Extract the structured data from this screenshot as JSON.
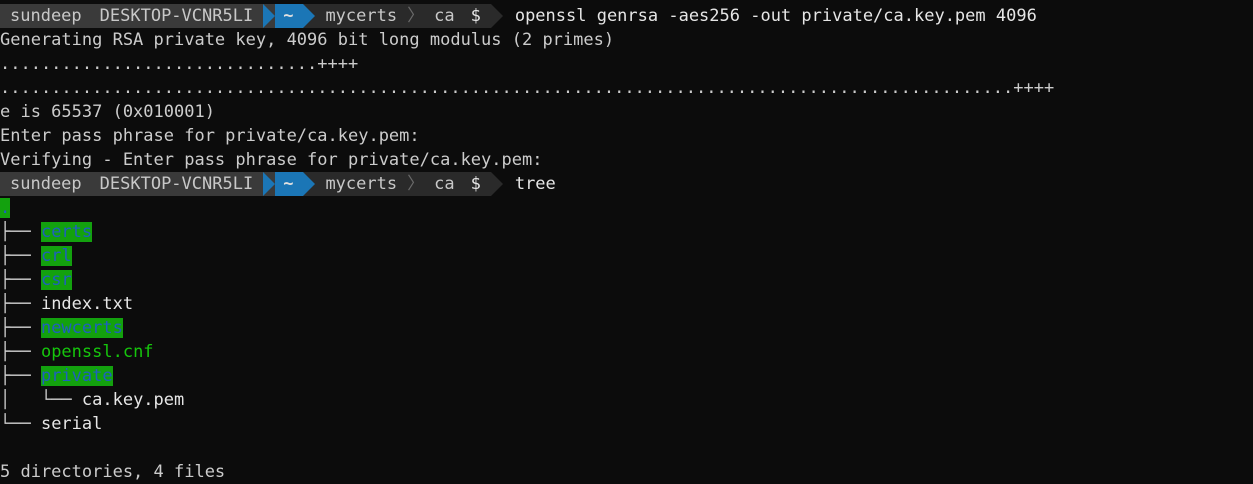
{
  "prompt1": {
    "user": "sundeep",
    "host": "DESKTOP-VCNR5LI",
    "home": "~",
    "dir1": "mycerts",
    "dir2": "ca",
    "dollar": "$",
    "command": "openssl genrsa -aes256 -out private/ca.key.pem 4096"
  },
  "output1": [
    "Generating RSA private key, 4096 bit long modulus (2 primes)",
    "...............................++++",
    "...................................................................................................++++",
    "e is 65537 (0x010001)",
    "Enter pass phrase for private/ca.key.pem:",
    "Verifying - Enter pass phrase for private/ca.key.pem:"
  ],
  "prompt2": {
    "user": "sundeep",
    "host": "DESKTOP-VCNR5LI",
    "home": "~",
    "dir1": "mycerts",
    "dir2": "ca",
    "dollar": "$",
    "command": "tree"
  },
  "tree": {
    "root": ".",
    "entries": [
      {
        "prefix": "├── ",
        "name": "certs",
        "type": "dir"
      },
      {
        "prefix": "├── ",
        "name": "crl",
        "type": "dir"
      },
      {
        "prefix": "├── ",
        "name": "csr",
        "type": "dir"
      },
      {
        "prefix": "├── ",
        "name": "index.txt",
        "type": "file"
      },
      {
        "prefix": "├── ",
        "name": "newcerts",
        "type": "dir"
      },
      {
        "prefix": "├── ",
        "name": "openssl.cnf",
        "type": "exec"
      },
      {
        "prefix": "├── ",
        "name": "private",
        "type": "dir"
      },
      {
        "prefix": "│   └── ",
        "name": "ca.key.pem",
        "type": "file"
      },
      {
        "prefix": "└── ",
        "name": "serial",
        "type": "file"
      }
    ],
    "summary": "5 directories, 4 files"
  }
}
